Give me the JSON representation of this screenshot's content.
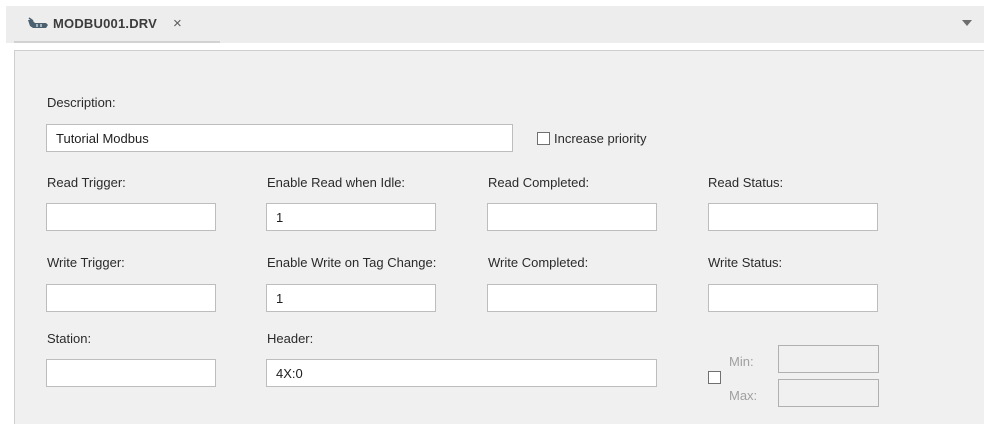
{
  "tab": {
    "title": "MODBU001.DRV",
    "close_glyph": "×",
    "icon": "driver-icon"
  },
  "form": {
    "description_label": "Description:",
    "description_value": "Tutorial Modbus",
    "increase_priority_label": "Increase priority",
    "read_trigger_label": "Read Trigger:",
    "read_trigger_value": "",
    "enable_read_idle_label": "Enable Read when Idle:",
    "enable_read_idle_value": "1",
    "read_completed_label": "Read Completed:",
    "read_completed_value": "",
    "read_status_label": "Read Status:",
    "read_status_value": "",
    "write_trigger_label": "Write Trigger:",
    "write_trigger_value": "",
    "enable_write_change_label": "Enable Write on Tag Change:",
    "enable_write_change_value": "1",
    "write_completed_label": "Write Completed:",
    "write_completed_value": "",
    "write_status_label": "Write Status:",
    "write_status_value": "",
    "station_label": "Station:",
    "station_value": "",
    "header_label": "Header:",
    "header_value": "4X:0",
    "min_label": "Min:",
    "max_label": "Max:",
    "min_value": "",
    "max_value": ""
  },
  "colors": {
    "panel_bg": "#f0f0f0",
    "tab_bg": "#ededed",
    "field_border": "#bdbdbd",
    "disabled_text": "#a0a0a0"
  }
}
